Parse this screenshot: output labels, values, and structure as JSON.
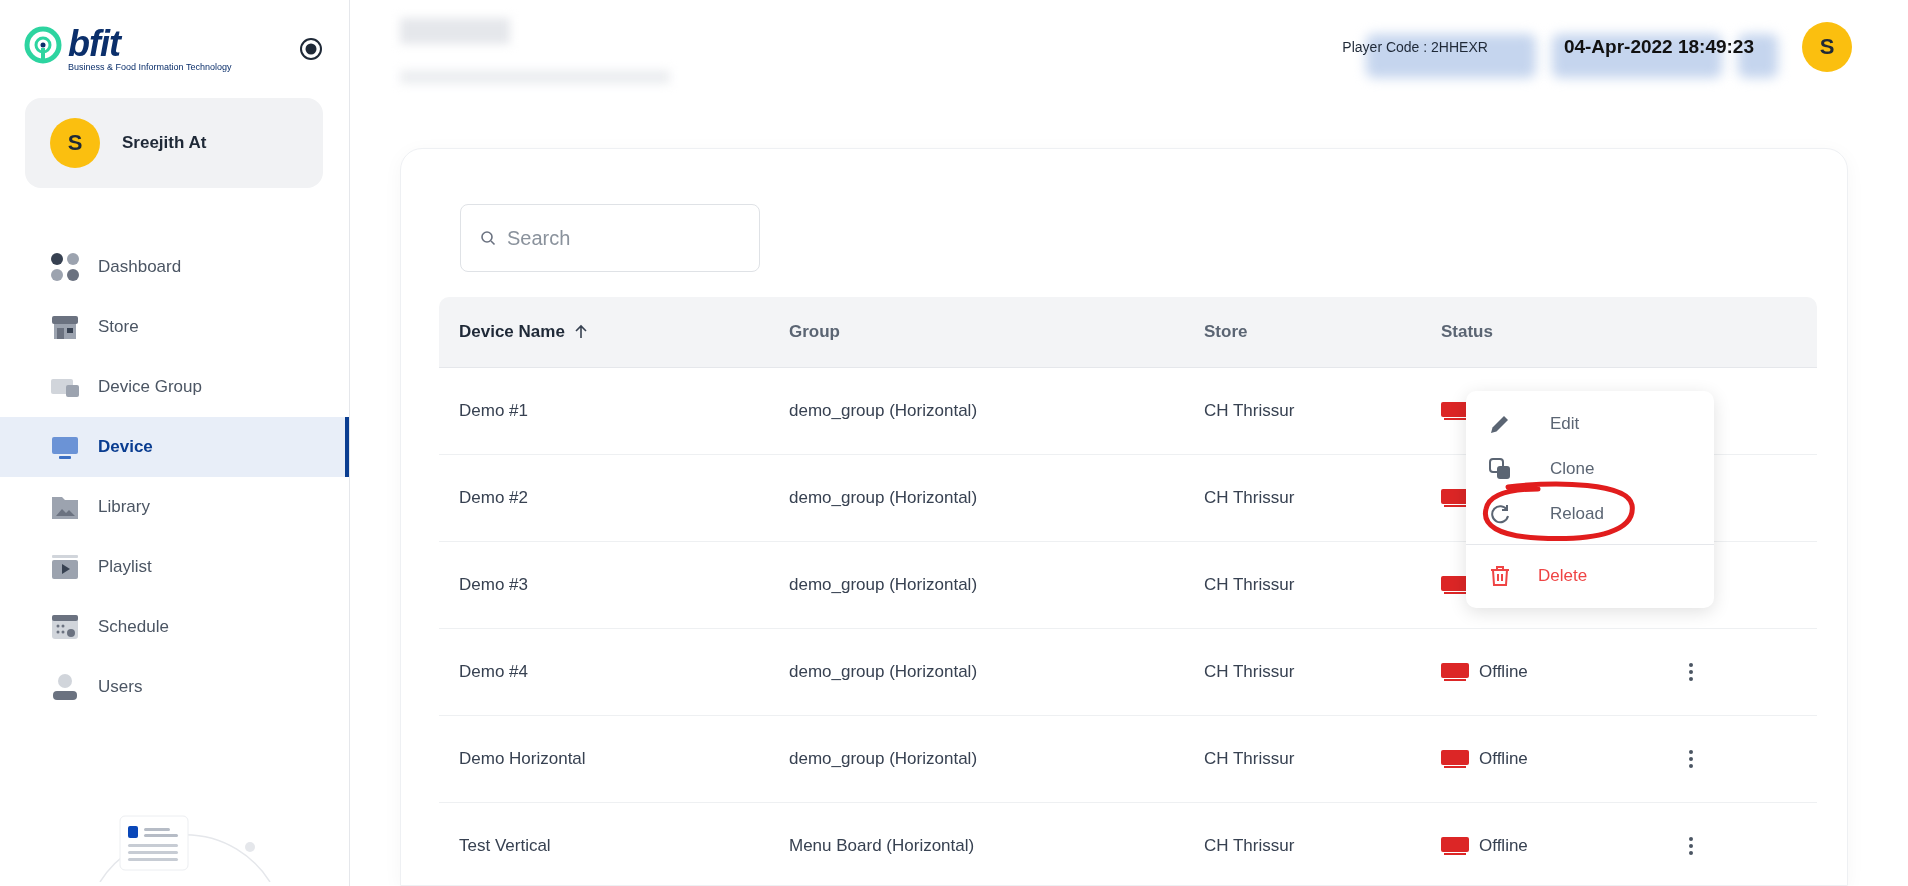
{
  "sidebar": {
    "brand": {
      "wordmark": "bfit",
      "tagline": "Business & Food Information Technology"
    },
    "user": {
      "initial": "S",
      "name": "Sreejith At"
    },
    "items": [
      {
        "label": "Dashboard",
        "selected": false
      },
      {
        "label": "Store",
        "selected": false
      },
      {
        "label": "Device Group",
        "selected": false
      },
      {
        "label": "Device",
        "selected": true
      },
      {
        "label": "Library",
        "selected": false
      },
      {
        "label": "Playlist",
        "selected": false
      },
      {
        "label": "Schedule",
        "selected": false
      },
      {
        "label": "Users",
        "selected": false
      }
    ]
  },
  "header": {
    "player_code": "Player Code : 2HHEXR",
    "datetime": "04-Apr-2022 18:49:23",
    "avatar_initial": "S"
  },
  "search": {
    "placeholder": "Search"
  },
  "table": {
    "columns": [
      {
        "label": "Device Name",
        "sorted": true
      },
      {
        "label": "Group",
        "sorted": false
      },
      {
        "label": "Store",
        "sorted": false
      },
      {
        "label": "Status",
        "sorted": false
      }
    ],
    "rows": [
      {
        "name": "Demo #1",
        "group": "demo_group (Horizontal)",
        "store": "CH Thrissur"
      },
      {
        "name": "Demo #2",
        "group": "demo_group (Horizontal)",
        "store": "CH Thrissur"
      },
      {
        "name": "Demo #3",
        "group": "demo_group (Horizontal)",
        "store": "CH Thrissur"
      },
      {
        "name": "Demo #4",
        "group": "demo_group (Horizontal)",
        "store": "CH Thrissur",
        "status": "Offline"
      },
      {
        "name": "Demo Horizontal",
        "group": "demo_group (Horizontal)",
        "store": "CH Thrissur",
        "status": "Offline"
      },
      {
        "name": "Test Vertical",
        "group": "Menu Board (Horizontal)",
        "store": "CH Thrissur",
        "status": "Offline"
      }
    ]
  },
  "context_menu": {
    "items": [
      {
        "label": "Edit",
        "kind": "edit",
        "highlighted": false
      },
      {
        "label": "Clone",
        "kind": "clone",
        "highlighted": false
      },
      {
        "label": "Reload",
        "kind": "reload",
        "highlighted": true
      },
      {
        "label": "Delete",
        "kind": "delete",
        "highlighted": false
      }
    ]
  }
}
